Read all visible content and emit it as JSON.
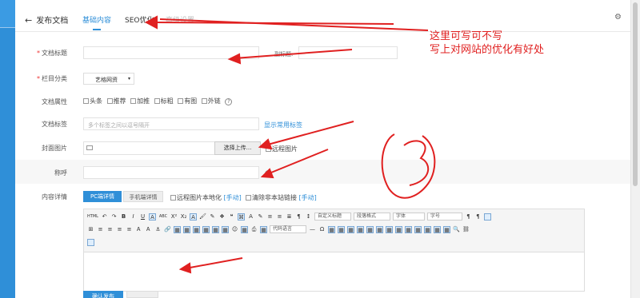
{
  "header": {
    "back_label": "发布文档",
    "tabs": [
      {
        "label": "基础内容",
        "active": true
      },
      {
        "label": "SEO优化",
        "active": false
      },
      {
        "label": "高级设置",
        "active": false
      }
    ]
  },
  "form": {
    "title_label": "文档标题",
    "subtitle_label": "副标题:",
    "category_label": "栏目分类",
    "category_value": "艺格网资",
    "attr_label": "文档属性",
    "attrs": [
      "头条",
      "推荐",
      "加推",
      "标粗",
      "有图",
      "外链"
    ],
    "tags_label": "文档标签",
    "tags_placeholder": "多个标签之间以逗号隔开",
    "tags_link": "显示常用标签",
    "cover_label": "封面图片",
    "upload_label": "选择上传...",
    "remote_label": "远程图片",
    "nick_label": "称呼",
    "content_label": "内容详情",
    "pc_tab": "PC端详情",
    "mobile_tab": "手机端详情",
    "opt1_text": "远程图片本地化",
    "opt1_link": "[手动]",
    "opt2_text": "清除非本站链接",
    "opt2_link": "[手动]",
    "bottom_btn": "确认发布"
  },
  "editor": {
    "selects": [
      "自定义标题",
      "段落格式",
      "字体",
      "字号"
    ],
    "code_select": "代码语言",
    "row1_icons": [
      "HTML",
      "↶",
      "↷",
      "B",
      "I",
      "U",
      "A",
      "ABC",
      "X²",
      "X₂",
      "A",
      "🖌",
      "✎",
      "❖",
      "❝",
      "⌘",
      "A",
      "✎",
      "≡",
      "≡"
    ],
    "row2_icons": [
      "⊞",
      "≡",
      "≡",
      "≡",
      "≡",
      "Ꭺ",
      "Ꭺ",
      "⚓",
      "🔗",
      "▦",
      "▦",
      "▦",
      "▦",
      "▦",
      "▦",
      "☺",
      "▦",
      "⎙",
      "▦"
    ],
    "row2_tail": [
      "—",
      "Ω",
      "▦",
      "▦",
      "▦",
      "▦",
      "▦",
      "▦",
      "▦",
      "▦",
      "▦",
      "▦",
      "▦",
      "▦",
      "▦",
      "🔍",
      "⛓"
    ]
  },
  "annotation": {
    "line1": "这里可写可不写",
    "line2": "写上对网站的优化有好处",
    "scribble": "3",
    "color": "#e02020"
  },
  "colors": {
    "accent": "#2f8fd8",
    "sidebar": "#2f8fd8"
  }
}
